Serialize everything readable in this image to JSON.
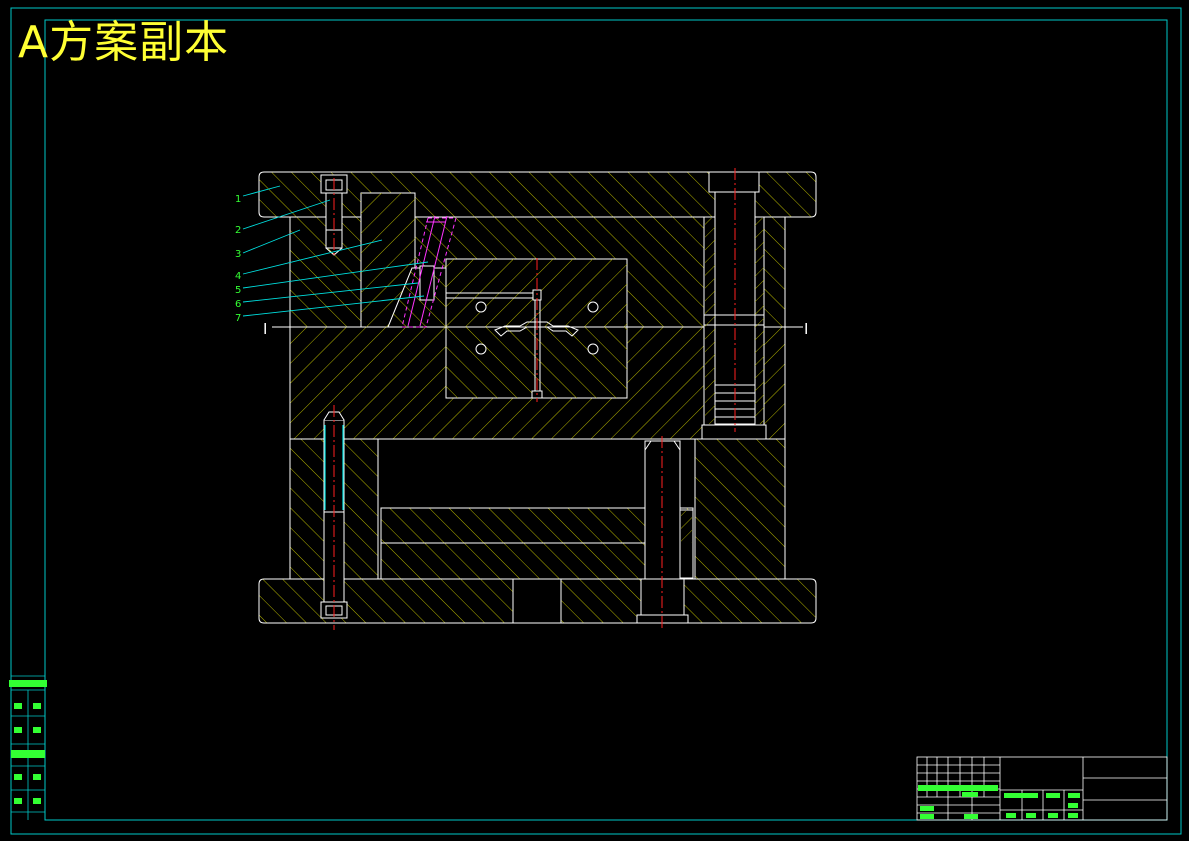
{
  "title": "A方案副本",
  "part_numbers": [
    "1",
    "2",
    "3",
    "4",
    "5",
    "6",
    "7"
  ],
  "section_label": "I",
  "colors": {
    "background": "#000000",
    "frame": "#00c8c8",
    "outline": "#ffffff",
    "hatch": "#c8c800",
    "centerline": "#ff2020",
    "leader": "#00e0e0",
    "part_number": "#33ff33",
    "slider": "#ff33ff",
    "title": "#ffff33"
  }
}
